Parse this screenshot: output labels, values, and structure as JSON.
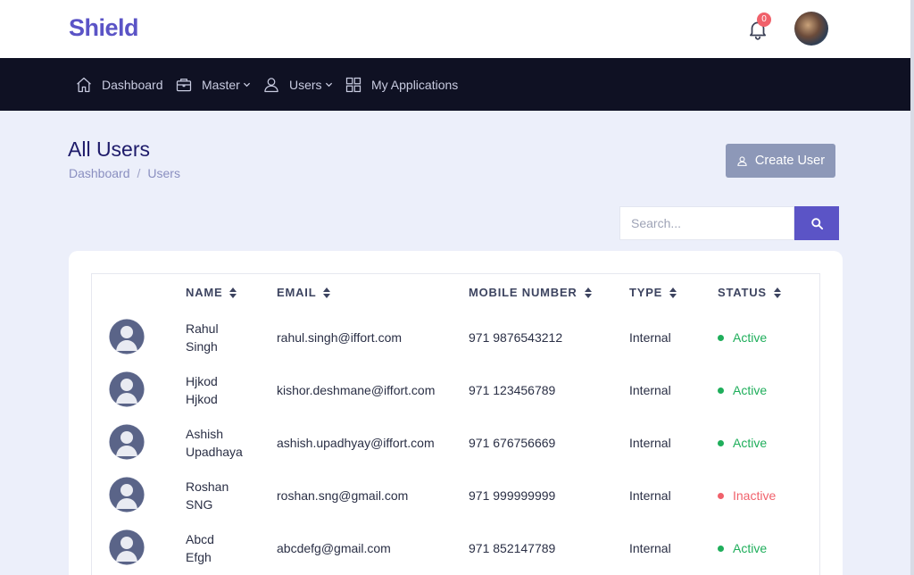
{
  "app": {
    "logo": "Shield"
  },
  "header": {
    "notification_count": "0"
  },
  "nav": {
    "items": [
      {
        "label": "Dashboard",
        "icon": "home-icon"
      },
      {
        "label": "Master",
        "icon": "briefcase-icon",
        "dropdown": true
      },
      {
        "label": "Users",
        "icon": "user-icon",
        "dropdown": true
      },
      {
        "label": "My Applications",
        "icon": "grid-icon"
      }
    ]
  },
  "page": {
    "title": "All Users",
    "breadcrumb": [
      "Dashboard",
      "Users"
    ],
    "create_button": "Create User"
  },
  "search": {
    "placeholder": "Search..."
  },
  "table": {
    "columns": [
      "NAME",
      "EMAIL",
      "MOBILE NUMBER",
      "TYPE",
      "STATUS"
    ],
    "rows": [
      {
        "first": "Rahul",
        "last": "Singh",
        "email": "rahul.singh@iffort.com",
        "mobile": "971 9876543212",
        "type": "Internal",
        "status": "Active"
      },
      {
        "first": "Hjkod",
        "last": "Hjkod",
        "email": "kishor.deshmane@iffort.com",
        "mobile": "971 123456789",
        "type": "Internal",
        "status": "Active"
      },
      {
        "first": "Ashish",
        "last": "Upadhaya",
        "email": "ashish.upadhyay@iffort.com",
        "mobile": "971 676756669",
        "type": "Internal",
        "status": "Active"
      },
      {
        "first": "Roshan",
        "last": "SNG",
        "email": "roshan.sng@gmail.com",
        "mobile": "971 999999999",
        "type": "Internal",
        "status": "Inactive"
      },
      {
        "first": "Abcd",
        "last": "Efgh",
        "email": "abcdefg@gmail.com",
        "mobile": "971 852147789",
        "type": "Internal",
        "status": "Active"
      }
    ]
  },
  "colors": {
    "brand": "#5b54c6",
    "nav_bg": "#0f1123",
    "active": "#1fae5b",
    "inactive": "#f0616b"
  }
}
